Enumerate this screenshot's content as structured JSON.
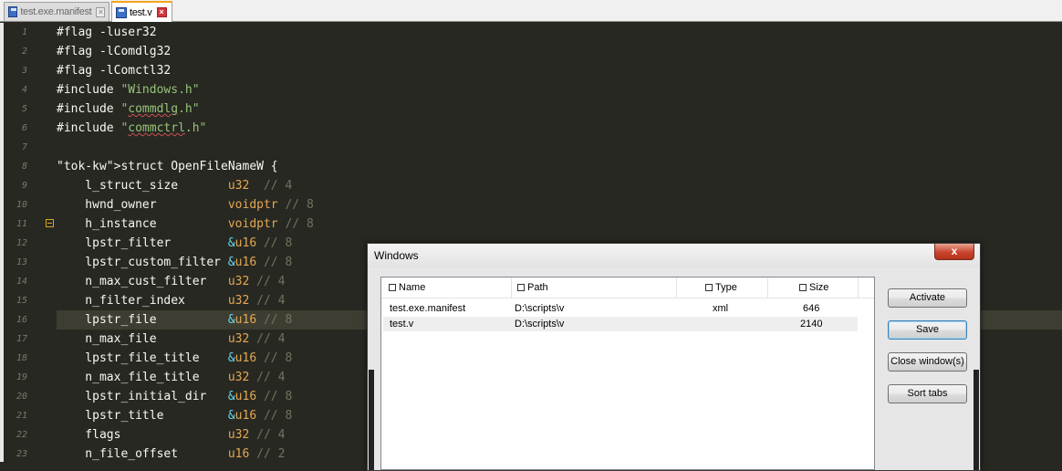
{
  "tabs": [
    {
      "label": "test.exe.manifest",
      "icon": "floppy-disk-icon",
      "active": false
    },
    {
      "label": "test.v",
      "icon": "floppy-disk-icon",
      "active": true
    }
  ],
  "editor": {
    "current_line": 16,
    "lines": [
      {
        "n": "1",
        "code": "#flag -luser32"
      },
      {
        "n": "2",
        "code": "#flag -lComdlg32"
      },
      {
        "n": "3",
        "code": "#flag -lComctl32"
      },
      {
        "n": "4",
        "code": "#include \"Windows.h\""
      },
      {
        "n": "5",
        "code": "#include \"commdlg.h\""
      },
      {
        "n": "6",
        "code": "#include \"commctrl.h\""
      },
      {
        "n": "7",
        "code": ""
      },
      {
        "n": "8",
        "code": "struct OpenFileNameW {"
      },
      {
        "n": "9",
        "code": "    l_struct_size       u32  // 4"
      },
      {
        "n": "10",
        "code": "    hwnd_owner          voidptr // 8"
      },
      {
        "n": "11",
        "code": "    h_instance          voidptr // 8"
      },
      {
        "n": "12",
        "code": "    lpstr_filter        &u16 // 8"
      },
      {
        "n": "13",
        "code": "    lpstr_custom_filter &u16 // 8"
      },
      {
        "n": "14",
        "code": "    n_max_cust_filter   u32 // 4"
      },
      {
        "n": "15",
        "code": "    n_filter_index      u32 // 4"
      },
      {
        "n": "16",
        "code": "    lpstr_file          &u16 // 8"
      },
      {
        "n": "17",
        "code": "    n_max_file          u32 // 4"
      },
      {
        "n": "18",
        "code": "    lpstr_file_title    &u16 // 8"
      },
      {
        "n": "19",
        "code": "    n_max_file_title    u32 // 4"
      },
      {
        "n": "20",
        "code": "    lpstr_initial_dir   &u16 // 8"
      },
      {
        "n": "21",
        "code": "    lpstr_title         &u16 // 8"
      },
      {
        "n": "22",
        "code": "    flags               u32 // 4"
      },
      {
        "n": "23",
        "code": "    n_file_offset       u16 // 2"
      }
    ]
  },
  "dialog": {
    "title": "Windows",
    "close_label": "x",
    "columns": [
      "Name",
      "Path",
      "Type",
      "Size"
    ],
    "rows": [
      {
        "name": "test.exe.manifest",
        "path": "D:\\scripts\\v",
        "type": "xml",
        "size": "646"
      },
      {
        "name": "test.v",
        "path": "D:\\scripts\\v",
        "type": "",
        "size": "2140"
      }
    ],
    "buttons": {
      "activate": "Activate",
      "save": "Save",
      "close_windows": "Close window(s)",
      "sort_tabs": "Sort tabs"
    }
  },
  "colors": {
    "editor_bg": "#272822",
    "current_line_bg": "#3e3d32",
    "keyword": "#c678dd",
    "string": "#98c379",
    "type": "#e6a852",
    "reference": "#66d9ef",
    "comment": "#75715e",
    "active_tab_accent": "#f4a51c"
  }
}
